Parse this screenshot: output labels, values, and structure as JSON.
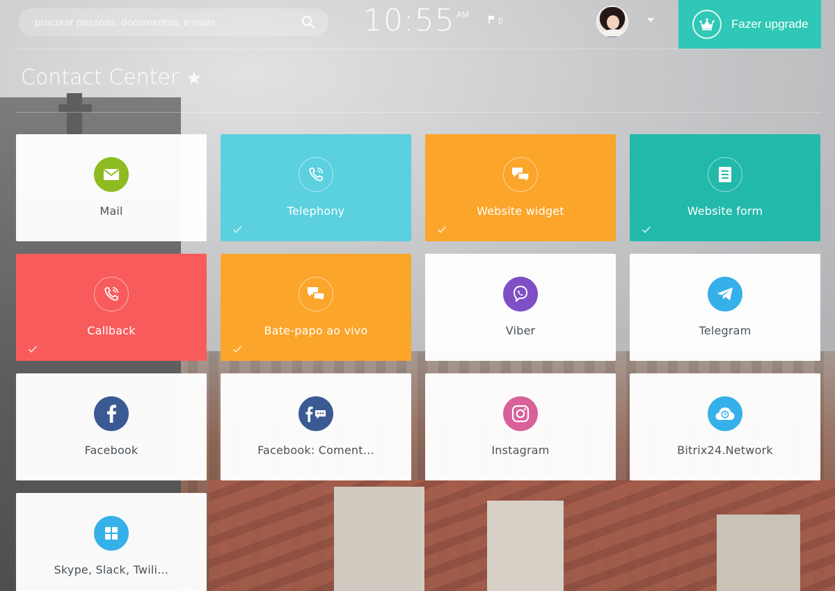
{
  "header": {
    "search": {
      "placeholder": "procurar pessoas, documentos, e mais"
    },
    "clock": {
      "time": "10:55",
      "ampm": "AM"
    },
    "flag_count": "0",
    "upgrade_label": "Fazer upgrade"
  },
  "page": {
    "title": "Contact Center"
  },
  "colors": {
    "upgrade": "#2fc7b5",
    "telephony": "#5bd0df",
    "website_widget": "#fba52b",
    "website_form": "#22b9ab",
    "callback": "#f85b5b",
    "live_chat": "#fba52b"
  },
  "tiles": [
    {
      "label": "Mail",
      "icon": "mail-icon",
      "style": "light",
      "checked": false
    },
    {
      "label": "Telephony",
      "icon": "phone-icon",
      "style": "colored",
      "checked": true
    },
    {
      "label": "Website widget",
      "icon": "chat-bubbles-icon",
      "style": "colored",
      "checked": true
    },
    {
      "label": "Website form",
      "icon": "form-icon",
      "style": "colored",
      "checked": true
    },
    {
      "label": "Callback",
      "icon": "phone-icon",
      "style": "colored",
      "checked": true
    },
    {
      "label": "Bate-papo ao vivo",
      "icon": "chat-bubbles-icon",
      "style": "colored",
      "checked": true
    },
    {
      "label": "Viber",
      "icon": "viber-icon",
      "style": "light",
      "checked": false
    },
    {
      "label": "Telegram",
      "icon": "telegram-icon",
      "style": "light",
      "checked": false
    },
    {
      "label": "Facebook",
      "icon": "facebook-icon",
      "style": "light",
      "checked": false
    },
    {
      "label": "Facebook: Coment…",
      "icon": "facebook-comments-icon",
      "style": "light",
      "checked": false
    },
    {
      "label": "Instagram",
      "icon": "instagram-icon",
      "style": "light",
      "checked": false
    },
    {
      "label": "Bitrix24.Network",
      "icon": "cloud-icon",
      "style": "light",
      "checked": false
    },
    {
      "label": "Skype, Slack, Twili…",
      "icon": "grid-apps-icon",
      "style": "light",
      "checked": false
    }
  ]
}
